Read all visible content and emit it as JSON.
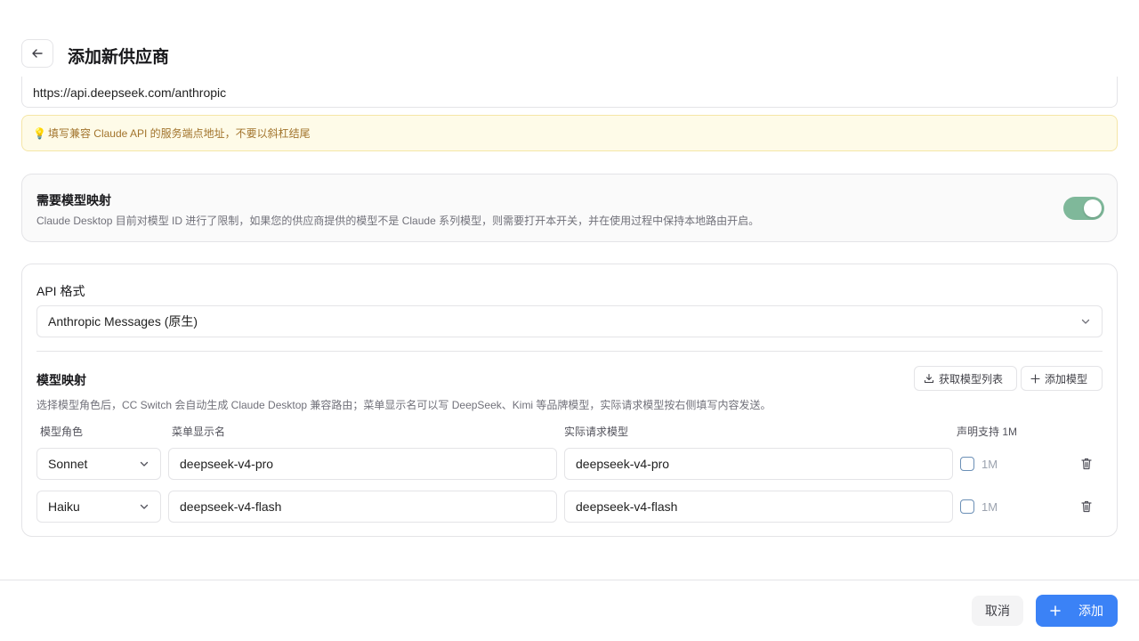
{
  "header": {
    "title": "添加新供应商"
  },
  "endpoint": {
    "value": "https://api.deepseek.com/anthropic",
    "hint": "填写兼容 Claude API 的服务端点地址，不要以斜杠结尾"
  },
  "model_mapping_toggle": {
    "title": "需要模型映射",
    "description": "Claude Desktop 目前对模型 ID 进行了限制，如果您的供应商提供的模型不是 Claude 系列模型，则需要打开本开关，并在使用过程中保持本地路由开启。",
    "enabled": true,
    "color": "#7fb89a"
  },
  "api_format": {
    "label": "API 格式",
    "selected": "Anthropic Messages (原生)"
  },
  "mapping": {
    "title": "模型映射",
    "description": "选择模型角色后，CC Switch 会自动生成 Claude Desktop 兼容路由；菜单显示名可以写 DeepSeek、Kimi 等品牌模型，实际请求模型按右侧填写内容发送。",
    "fetch_button": "获取模型列表",
    "add_model_button": "添加模型",
    "columns": [
      "模型角色",
      "菜单显示名",
      "实际请求模型",
      "声明支持 1M"
    ],
    "rows": [
      {
        "role": "Sonnet",
        "display_name": "deepseek-v4-pro",
        "request_model": "deepseek-v4-pro",
        "support_1m_label": "1M",
        "support_1m": false
      },
      {
        "role": "Haiku",
        "display_name": "deepseek-v4-flash",
        "request_model": "deepseek-v4-flash",
        "support_1m_label": "1M",
        "support_1m": false
      }
    ]
  },
  "footer": {
    "cancel": "取消",
    "add": "添加",
    "primary_color": "#3b82f6"
  }
}
